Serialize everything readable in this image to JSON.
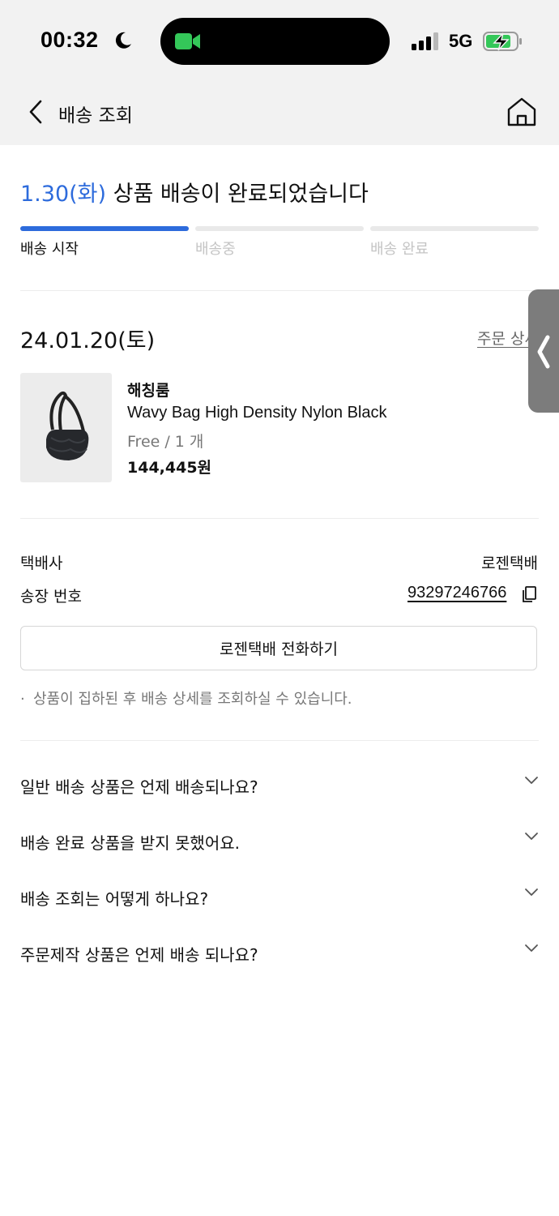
{
  "status_bar": {
    "time": "00:32",
    "network": "5G"
  },
  "nav": {
    "title": "배송 조회",
    "icons": [
      "back-chevron-icon",
      "home-icon"
    ]
  },
  "delivery": {
    "headline_date": "1.30(화)",
    "headline_text": " 상품 배송이 완료되었습니다",
    "steps": [
      {
        "label": "배송 시작",
        "active": true
      },
      {
        "label": "배송중",
        "active": false
      },
      {
        "label": "배송 완료",
        "active": false
      }
    ],
    "accent_color": "#2d6bdc"
  },
  "order": {
    "date": "24.01.20(토)",
    "detail_link": "주문 상세",
    "product": {
      "brand": "해칭룸",
      "name": "Wavy Bag High Density Nylon Black",
      "option": "Free / 1 개",
      "price": "144,445원"
    }
  },
  "shipping": {
    "carrier_label": "택배사",
    "carrier_value": "로젠택배",
    "tracking_label": "송장 번호",
    "tracking_number": "93297246766",
    "call_button": "로젠택배 전화하기",
    "note": "상품이 집하된 후 배송 상세를 조회하실 수 있습니다."
  },
  "faq": [
    {
      "question": "일반 배송 상품은 언제 배송되나요?"
    },
    {
      "question": "배송 완료 상품을 받지 못했어요."
    },
    {
      "question": "배송 조회는 어떻게 하나요?"
    },
    {
      "question": "주문제작 상품은 언제 배송 되나요?"
    }
  ]
}
